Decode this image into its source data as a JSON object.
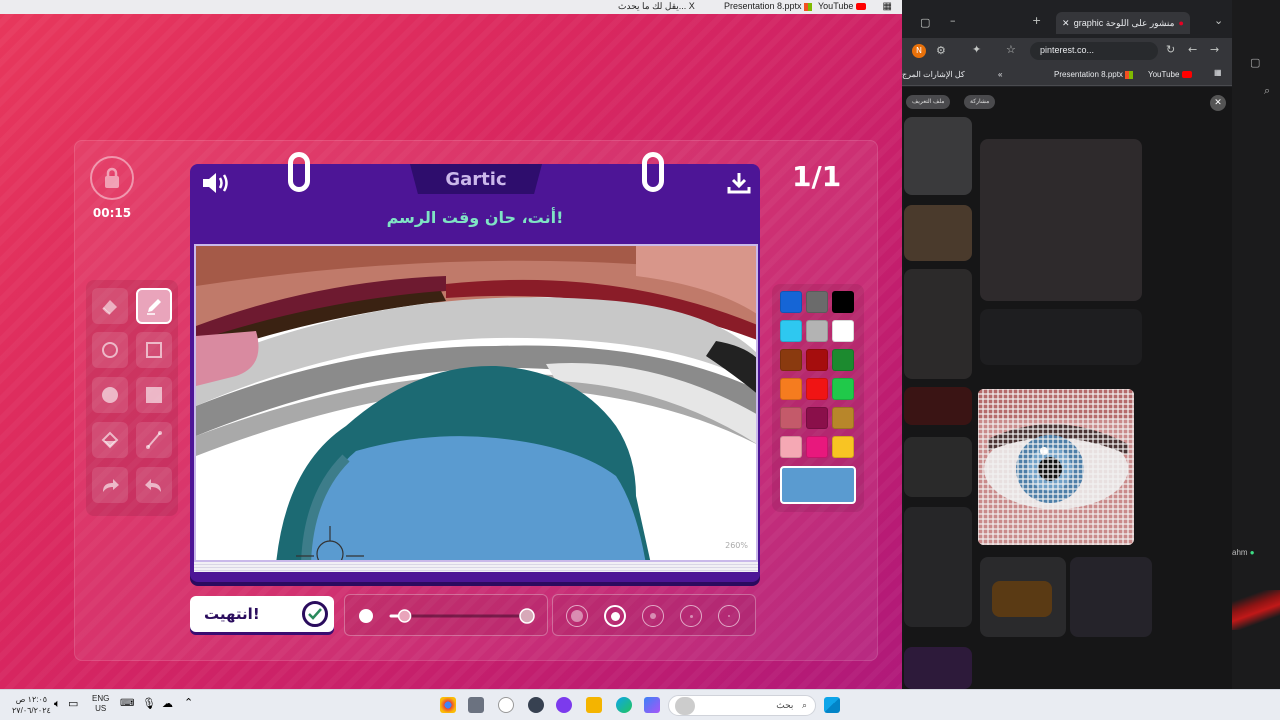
{
  "top_bookmarks": {
    "item1": "يقل لك ما يحدث... X",
    "item2": "Presentation 8.pptx",
    "item3": "YouTube"
  },
  "game": {
    "timer": "00:15",
    "round": "1/1",
    "logo": "Gartic",
    "prompt": "أنت، حان وقت الرسم!",
    "zoom": "260%",
    "done_label": "انتهيت!",
    "icons": {
      "lock": "lock-icon",
      "speaker": "speaker-icon",
      "download": "download-icon",
      "done": "check-circle-icon"
    },
    "tools": [
      {
        "name": "eraser",
        "active": false
      },
      {
        "name": "pencil",
        "active": true
      },
      {
        "name": "ellipse-outline",
        "active": false
      },
      {
        "name": "rectangle-outline",
        "active": false
      },
      {
        "name": "ellipse-filled",
        "active": false
      },
      {
        "name": "rectangle-filled",
        "active": false
      },
      {
        "name": "fill-bucket",
        "active": false
      },
      {
        "name": "line",
        "active": false
      },
      {
        "name": "redo",
        "active": false
      },
      {
        "name": "undo",
        "active": false
      }
    ],
    "palette": [
      "#1565d6",
      "#6b6b6b",
      "#000000",
      "#2ec8f0",
      "#b3b3b3",
      "#ffffff",
      "#8a3a0f",
      "#a50d0d",
      "#1c8a2f",
      "#f57c1f",
      "#f01414",
      "#20c94a",
      "#c45a6a",
      "#8a0f4a",
      "#b8862a",
      "#f5a8b4",
      "#e8187d",
      "#f8c423"
    ],
    "selected_color": "#5a9bd0",
    "opacity_level": 0.1,
    "brush_sizes": 5,
    "selected_brush_size": 2
  },
  "browser": {
    "tab_title": "graphic منشور على اللوحة",
    "url": "pinterest.co...",
    "bookmarks": {
      "all_bookmarks": "كل الإشارات المرج",
      "presentation": "Presentation 8.pptx",
      "youtube": "YouTube"
    },
    "pill_share": "مشاركة",
    "pill_profile": "ملف التعريف",
    "avatar_letter": "N",
    "side_text": "ahm"
  },
  "taskbar": {
    "search_placeholder": "بحث",
    "lang_top": "ENG",
    "lang_bottom": "US",
    "time": "١٢:٠٥ ص",
    "date": "٢٧/٠٦/٢٠٢٤"
  }
}
